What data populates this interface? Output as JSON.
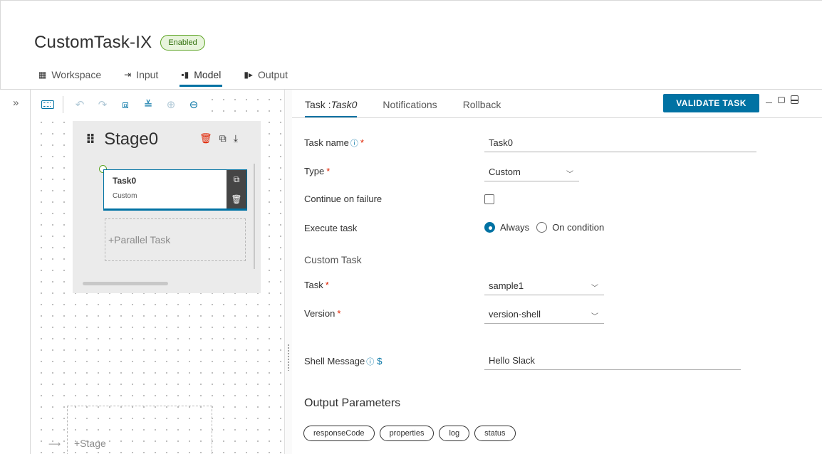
{
  "header": {
    "title": "CustomTask-IX",
    "status_badge": "Enabled"
  },
  "nav_tabs": [
    {
      "label": "Workspace",
      "icon": "workspace-icon",
      "active": false
    },
    {
      "label": "Input",
      "icon": "input-icon",
      "active": false
    },
    {
      "label": "Model",
      "icon": "model-icon",
      "active": true
    },
    {
      "label": "Output",
      "icon": "output-icon",
      "active": false
    }
  ],
  "canvas": {
    "toolbar_icons": [
      "keyboard-icon",
      "undo-icon",
      "redo-icon",
      "fit-view-icon",
      "align-icon",
      "zoom-in-icon",
      "zoom-out-icon"
    ],
    "stage": {
      "name": "Stage0",
      "task": {
        "name": "Task0",
        "type": "Custom"
      },
      "parallel_task_label": "+Parallel Task"
    },
    "add_stage_label": "+Stage"
  },
  "panel": {
    "tabs": {
      "task_prefix": "Task : ",
      "task_name": "Task0",
      "notifications": "Notifications",
      "rollback": "Rollback"
    },
    "validate_label": "VALIDATE TASK",
    "fields": {
      "task_name_label": "Task name",
      "task_name_value": "Task0",
      "type_label": "Type",
      "type_value": "Custom",
      "continue_label": "Continue on failure",
      "execute_label": "Execute task",
      "execute_always": "Always",
      "execute_condition": "On condition",
      "custom_task_section": "Custom Task",
      "task_label": "Task",
      "task_value": "sample1",
      "version_label": "Version",
      "version_value": "version-shell",
      "shell_label": "Shell Message",
      "shell_value": "Hello Slack"
    },
    "output_title": "Output Parameters",
    "output_params": [
      "responseCode",
      "properties",
      "log",
      "status"
    ]
  },
  "colors": {
    "accent": "#0072a3",
    "success": "#5aa220",
    "danger": "#e02200"
  }
}
